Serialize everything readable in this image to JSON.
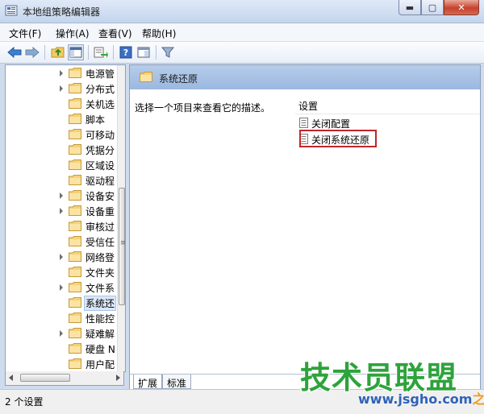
{
  "window": {
    "title": "本地组策略编辑器"
  },
  "menu": [
    "文件(F)",
    "操作(A)",
    "查看(V)",
    "帮助(H)"
  ],
  "tree": {
    "items": [
      {
        "label": "电源管",
        "expandable": true
      },
      {
        "label": "分布式",
        "expandable": true
      },
      {
        "label": "关机选",
        "expandable": false
      },
      {
        "label": "脚本",
        "expandable": false
      },
      {
        "label": "可移动",
        "expandable": false
      },
      {
        "label": "凭据分",
        "expandable": false
      },
      {
        "label": "区域设",
        "expandable": false
      },
      {
        "label": "驱动程",
        "expandable": false
      },
      {
        "label": "设备安",
        "expandable": true
      },
      {
        "label": "设备重",
        "expandable": true
      },
      {
        "label": "审核过",
        "expandable": false
      },
      {
        "label": "受信任",
        "expandable": false
      },
      {
        "label": "网络登",
        "expandable": true
      },
      {
        "label": "文件夹",
        "expandable": false
      },
      {
        "label": "文件系",
        "expandable": true
      },
      {
        "label": "系统还",
        "expandable": false,
        "selected": true
      },
      {
        "label": "性能控",
        "expandable": false
      },
      {
        "label": "疑难解",
        "expandable": true
      },
      {
        "label": "硬盘 N",
        "expandable": false
      },
      {
        "label": "用户配",
        "expandable": false
      }
    ]
  },
  "details": {
    "header_title": "系统还原",
    "description": "选择一个项目来查看它的描述。",
    "list_header": "设置",
    "items": [
      "关闭配置",
      "关闭系统还原"
    ]
  },
  "tabs": [
    "扩展",
    "标准"
  ],
  "status": {
    "text": "2 个设置"
  },
  "watermark": {
    "main": "技术员联盟",
    "url": "www.jsgho.com",
    "tail": "之家"
  },
  "colors": {
    "highlight": "#c0262a",
    "watermark_green": "#2ea33c"
  }
}
